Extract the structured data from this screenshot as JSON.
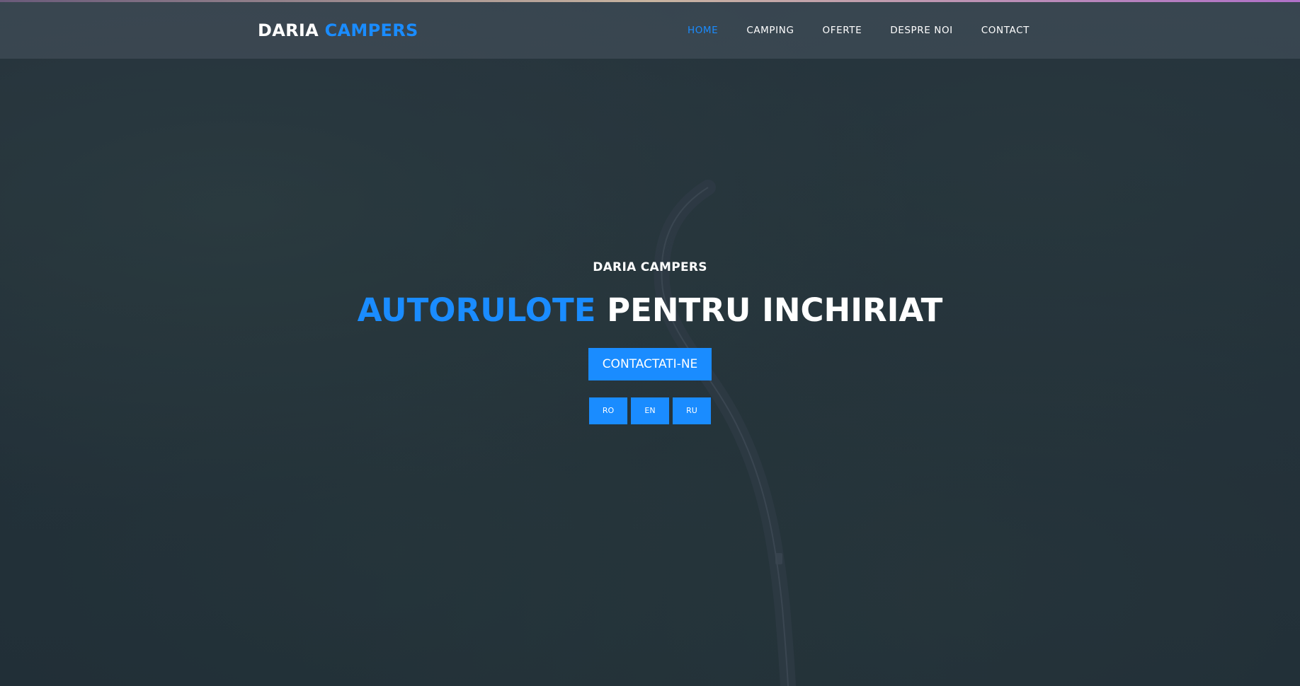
{
  "header": {
    "logo_main": "DARIA",
    "logo_accent": "CAMPERS",
    "nav": [
      {
        "label": "HOME"
      },
      {
        "label": "CAMPING"
      },
      {
        "label": "OFERTE"
      },
      {
        "label": "DESPRE NOI"
      },
      {
        "label": "CONTACT"
      }
    ]
  },
  "hero": {
    "eyebrow": "DARIA CAMPERS",
    "headline_accent": "AUTORULOTE",
    "headline_rest": "PENTRU INCHIRIAT",
    "cta_label": "CONTACTATI-NE",
    "languages": [
      {
        "label": "RO"
      },
      {
        "label": "EN"
      },
      {
        "label": "RU"
      }
    ]
  },
  "colors": {
    "accent": "#1a8cff",
    "text": "#ffffff",
    "background": "#26343c"
  }
}
